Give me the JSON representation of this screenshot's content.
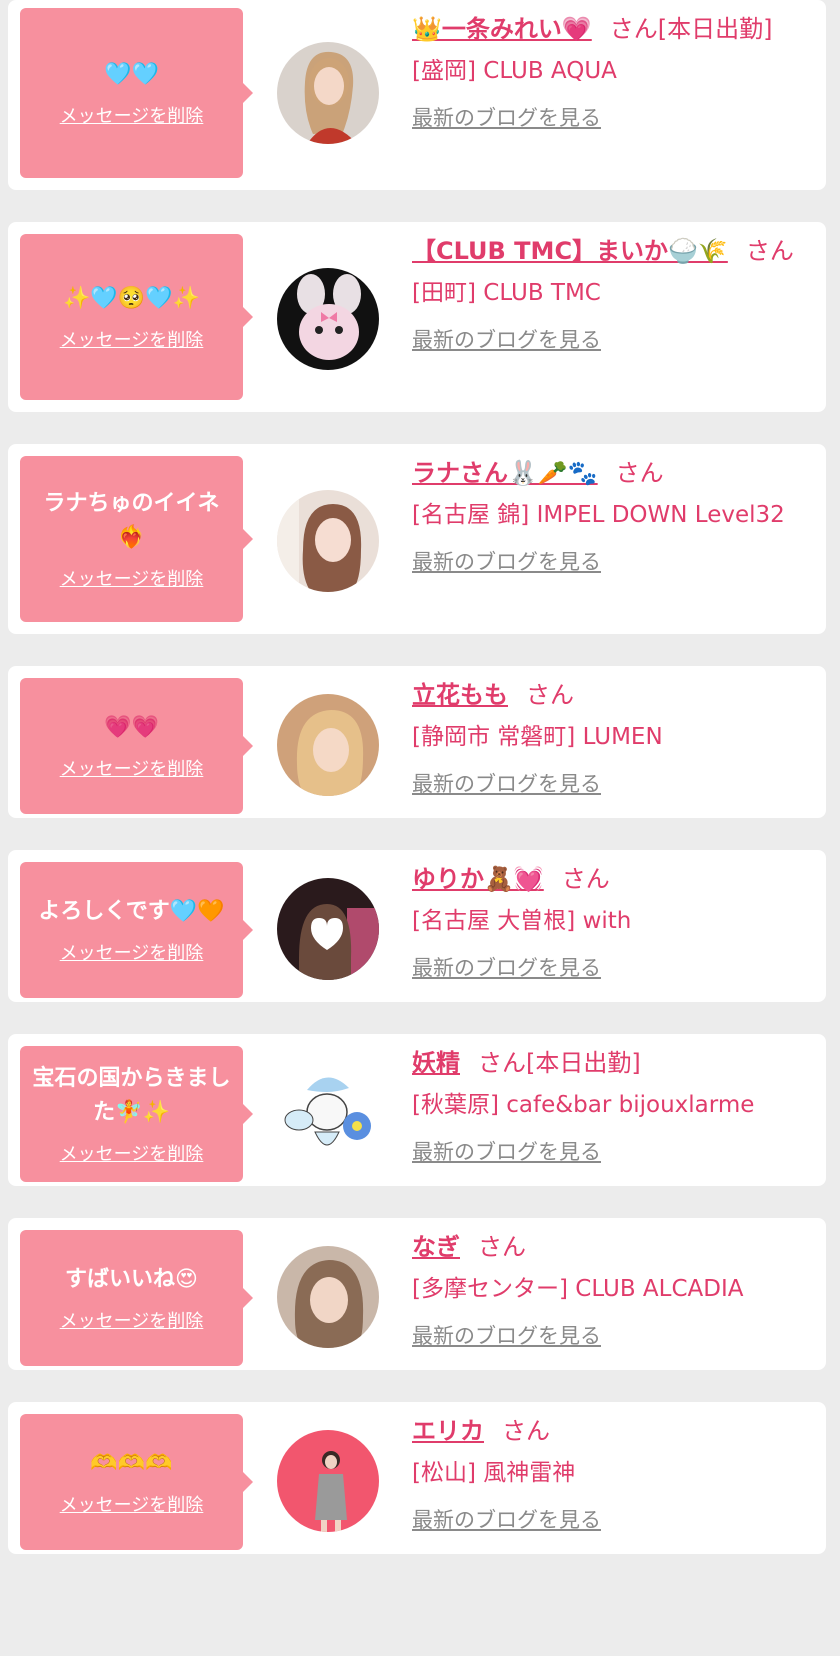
{
  "colors": {
    "bubble": "#f7909e",
    "accent": "#e03c6b",
    "blog_link": "#8a8a8a",
    "background": "#ececec"
  },
  "delete_label": "メッセージを削除",
  "blog_label": "最新のブログを見る",
  "entries": [
    {
      "message": "🩵🩵",
      "name": "👑一条みれい💗",
      "honorific": "さん",
      "status": "[本日出勤]",
      "shop": "[盛岡] CLUB AQUA",
      "avatar": "person-photo"
    },
    {
      "message": "✨🩵🥺🩵✨",
      "name": "【CLUB TMC】まいか🍚🌾",
      "honorific": "さん",
      "status": "",
      "shop": "[田町] CLUB TMC",
      "avatar": "bunny-illustration"
    },
    {
      "message": "ラナちゅのイイネ❤️‍🔥",
      "name": "ラナさん🐰🥕🐾",
      "honorific": "さん",
      "status": "",
      "shop": "[名古屋 錦] IMPEL DOWN Level32",
      "avatar": "person-photo"
    },
    {
      "message": "💗💗",
      "name": "立花もも",
      "honorific": "さん",
      "status": "",
      "shop": "[静岡市 常磐町] LUMEN",
      "avatar": "person-photo"
    },
    {
      "message": "よろしくです🩵🧡",
      "name": "ゆりか🧸💓",
      "honorific": "さん",
      "status": "",
      "shop": "[名古屋 大曽根] with",
      "avatar": "person-photo-heart"
    },
    {
      "message": "宝石の国からきました🧚✨",
      "name": "妖精",
      "honorific": "さん",
      "status": "[本日出勤]",
      "shop": "[秋葉原] cafe&bar bijouxlarme",
      "avatar": "fairy-illustration"
    },
    {
      "message": "すばいいね😍",
      "name": "なぎ",
      "honorific": "さん",
      "status": "",
      "shop": "[多摩センター] CLUB ALCADIA",
      "avatar": "person-photo"
    },
    {
      "message": "🫶🫶🫶",
      "name": "エリカ",
      "honorific": "さん",
      "status": "",
      "shop": "[松山] 風神雷神",
      "avatar": "person-photo-pink"
    }
  ]
}
